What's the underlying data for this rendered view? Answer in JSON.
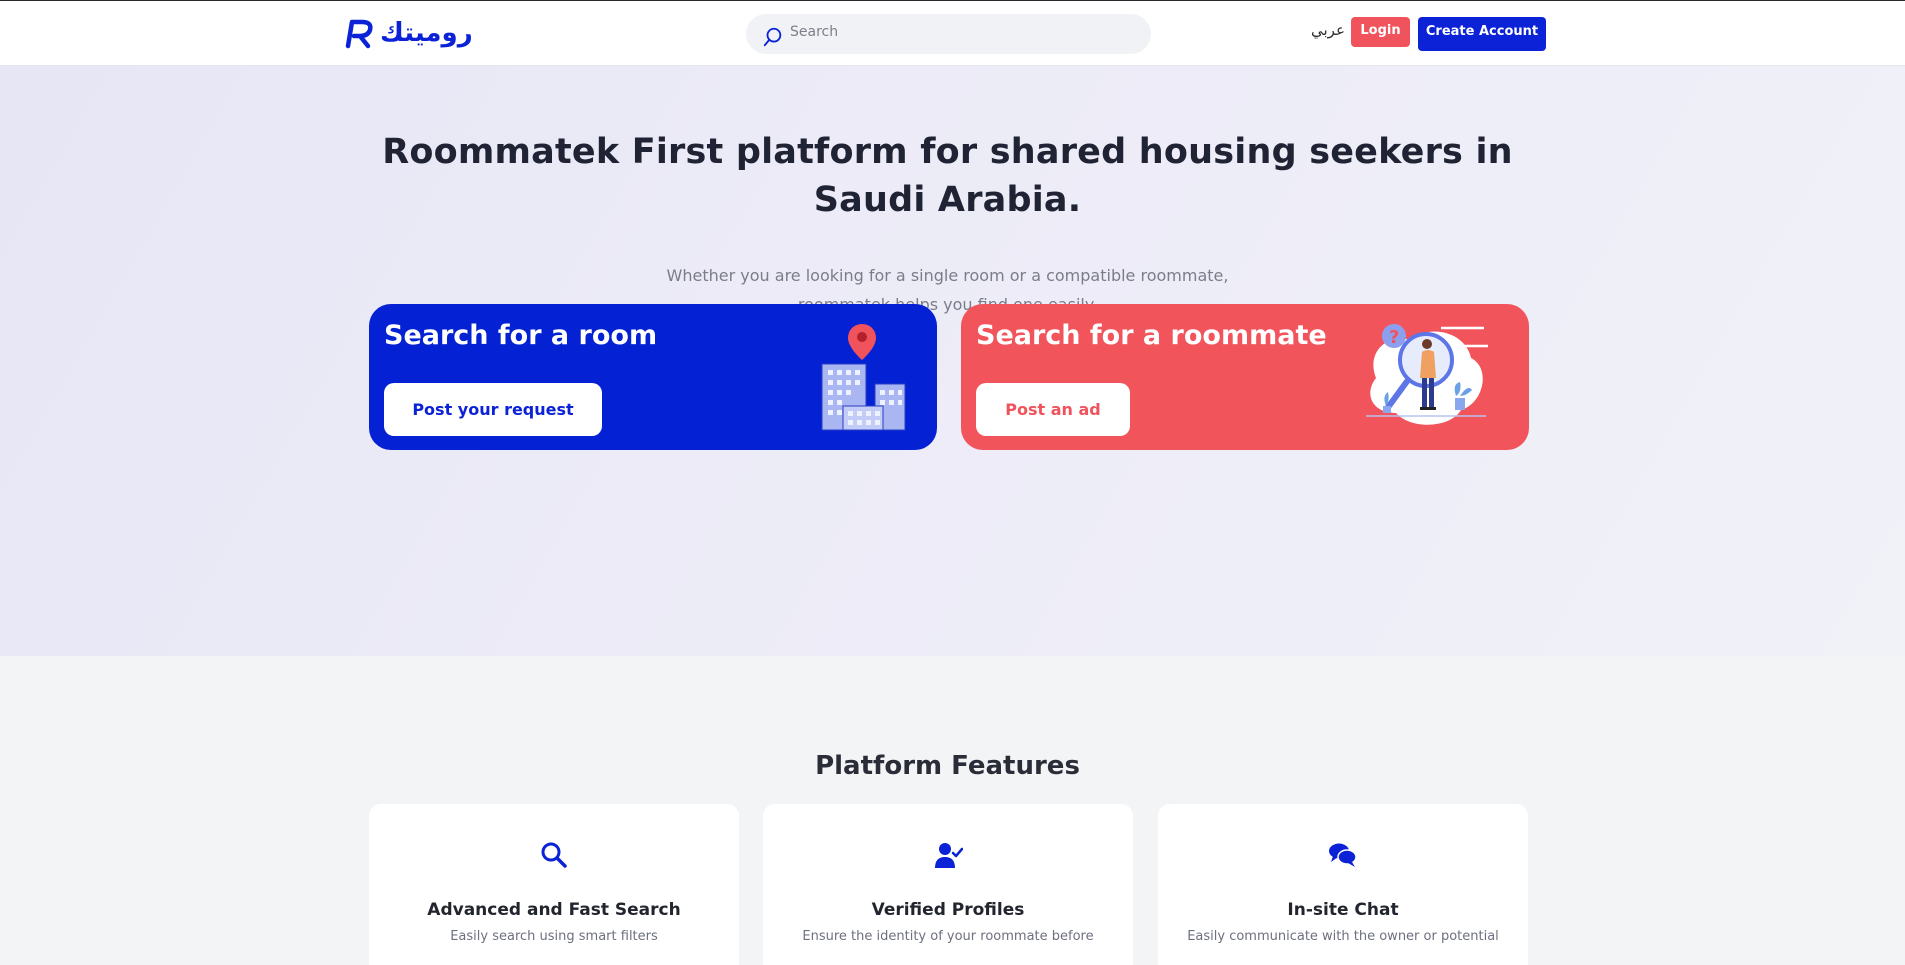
{
  "header": {
    "logo_text": "روميتك",
    "search_placeholder": "Search",
    "lang_label": "عربي",
    "login_label": "Login",
    "create_account_label": "Create Account"
  },
  "hero": {
    "title": "Roommatek First platform for shared housing seekers in Saudi Arabia.",
    "subtitle_line1": "Whether you are looking for a single room or a compatible roommate,",
    "subtitle_line2": "roommatek helps you find one easily."
  },
  "cards": {
    "room": {
      "title": "Search for a room",
      "button": "Post your request"
    },
    "roommate": {
      "title": "Search for a roommate",
      "button": "Post an ad"
    }
  },
  "features": {
    "title": "Platform Features",
    "items": [
      {
        "icon": "search-icon",
        "title": "Advanced and Fast Search",
        "desc": "Easily search using smart filters"
      },
      {
        "icon": "verified-user-icon",
        "title": "Verified Profiles",
        "desc": "Ensure the identity of your roommate before"
      },
      {
        "icon": "chat-bubbles-icon",
        "title": "In-site Chat",
        "desc": "Easily communicate with the owner or potential"
      }
    ]
  },
  "colors": {
    "brand_blue": "#0b22d6",
    "brand_red": "#f0535c",
    "hero_bg": "#ecebf7",
    "features_bg": "#f3f4f6"
  }
}
